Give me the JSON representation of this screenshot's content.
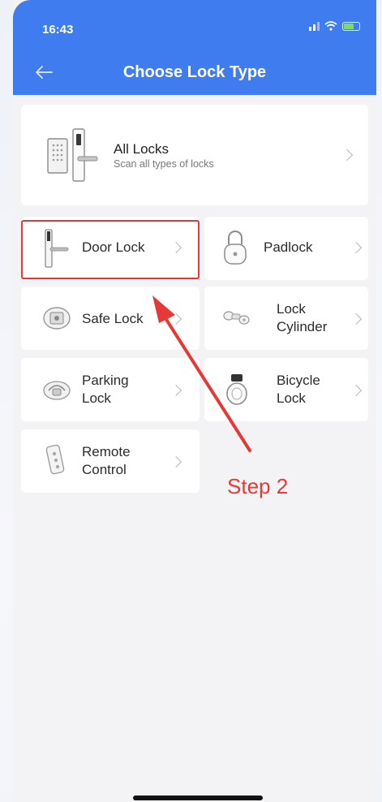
{
  "status_bar": {
    "time": "16:43"
  },
  "header": {
    "title": "Choose Lock Type"
  },
  "all_locks": {
    "title": "All Locks",
    "subtitle": "Scan all types of locks"
  },
  "lock_types": [
    {
      "label": "Door Lock",
      "icon": "door-lock-icon"
    },
    {
      "label": "Padlock",
      "icon": "padlock-icon"
    },
    {
      "label": "Safe Lock",
      "icon": "safe-lock-icon"
    },
    {
      "label": "Lock\nCylinder",
      "icon": "lock-cylinder-icon"
    },
    {
      "label": "Parking\nLock",
      "icon": "parking-lock-icon"
    },
    {
      "label": "Bicycle\nLock",
      "icon": "bicycle-lock-icon"
    },
    {
      "label": "Remote\nControl",
      "icon": "remote-control-icon"
    }
  ],
  "annotation": {
    "label": "Step 2"
  },
  "colors": {
    "header": "#3f7cf0",
    "highlight": "#e53935",
    "card": "#ffffff",
    "background": "#f3f3f5"
  }
}
